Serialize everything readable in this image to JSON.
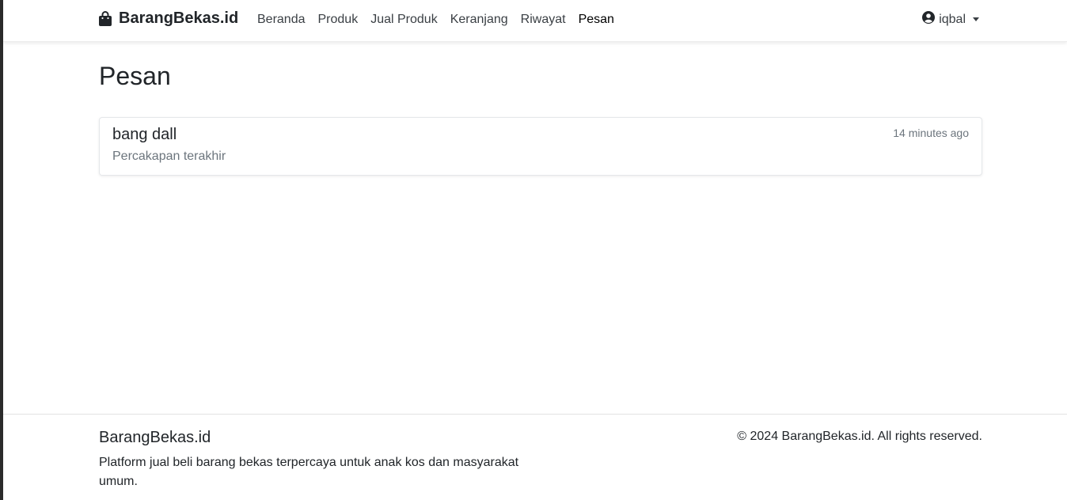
{
  "navbar": {
    "brand": "BarangBekas.id",
    "links": [
      {
        "label": "Beranda"
      },
      {
        "label": "Produk"
      },
      {
        "label": "Jual Produk"
      },
      {
        "label": "Keranjang"
      },
      {
        "label": "Riwayat"
      },
      {
        "label": "Pesan",
        "active": true
      }
    ],
    "user": "iqbal"
  },
  "main": {
    "title": "Pesan",
    "conversations": [
      {
        "name": "bang dall",
        "preview": "Percakapan terakhir",
        "time": "14 minutes ago"
      }
    ]
  },
  "footer": {
    "brand": "BarangBekas.id",
    "description": "Platform jual beli barang bekas terpercaya untuk anak kos dan masyarakat umum.",
    "copyright": "© 2024 BarangBekas.id. All rights reserved."
  },
  "colors": {
    "text": "#212529",
    "muted": "#6c757d",
    "border": "#e5e7ea"
  }
}
